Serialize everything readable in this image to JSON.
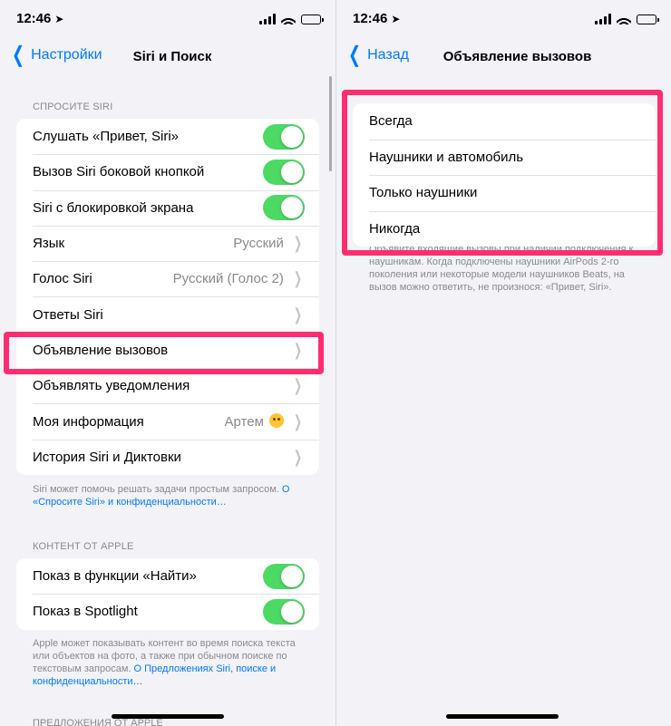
{
  "status_bar": {
    "time": "12:46"
  },
  "left": {
    "nav": {
      "back_label": "Настройки",
      "title": "Siri и Поиск"
    },
    "section1": {
      "header": "СПРОСИТЕ SIRI",
      "rows": [
        {
          "label": "Слушать «Привет, Siri»",
          "toggle": true
        },
        {
          "label": "Вызов Siri боковой кнопкой",
          "toggle": true
        },
        {
          "label": "Siri с блокировкой экрана",
          "toggle": true
        },
        {
          "label": "Язык",
          "value": "Русский"
        },
        {
          "label": "Голос Siri",
          "value": "Русский (Голос 2)"
        },
        {
          "label": "Ответы Siri"
        },
        {
          "label": "Объявление вызовов"
        },
        {
          "label": "Объявлять уведомления"
        },
        {
          "label": "Моя информация",
          "value": "Артем"
        },
        {
          "label": "История Siri и Диктовки"
        }
      ],
      "footer_text": "Siri может помочь решать задачи простым запросом. ",
      "footer_link": "О «Спросите Siri» и конфиденциальности…"
    },
    "section2": {
      "header": "КОНТЕНТ ОТ APPLE",
      "rows": [
        {
          "label": "Показ в функции «Найти»",
          "toggle": true
        },
        {
          "label": "Показ в Spotlight",
          "toggle": true
        }
      ],
      "footer_text": "Apple может показывать контент во время поиска текста или объектов на фото, а также при обычном поиске по текстовым запросам. ",
      "footer_link": "О Предложениях Siri, поиске и конфиденциальности…"
    },
    "section3_header_peek": "ПРЕДЛОЖЕНИЯ ОТ APPLE"
  },
  "right": {
    "nav": {
      "back_label": "Назад",
      "title": "Объявление вызовов"
    },
    "options": [
      "Всегда",
      "Наушники и автомобиль",
      "Только наушники",
      "Никогда"
    ],
    "footer": "Объявите входящие вызовы при наличии подключения к наушникам. Когда подключены наушники AirPods 2-го поколения или некоторые модели наушников Beats, на вызов можно ответить, не произнося: «Привет, Siri»."
  },
  "colors": {
    "accent": "#007aff",
    "toggle_on": "#4cd964",
    "highlight": "#ff2d6f"
  }
}
